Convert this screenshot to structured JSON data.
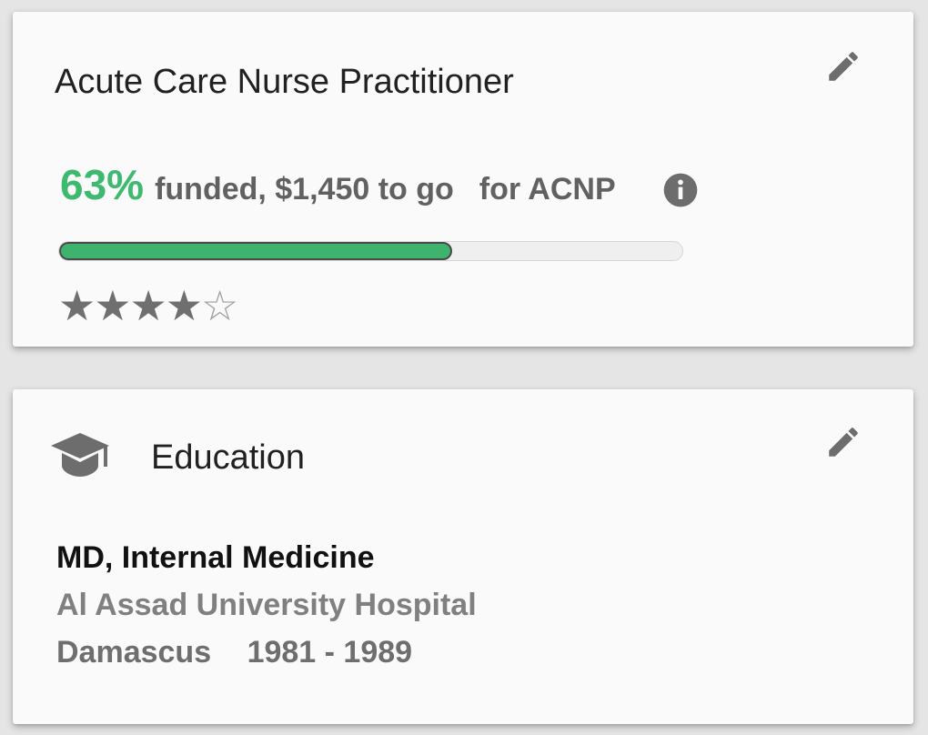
{
  "goal_card": {
    "title": "Acute Care Nurse Practitioner",
    "funded_percent": "63%",
    "funded_text": "funded, $1,450 to go",
    "for_text": "for ACNP",
    "progress_fraction": 0.63,
    "rating": {
      "filled": 4,
      "total": 5,
      "filled_glyph": "★",
      "empty_glyph": "☆"
    },
    "icons": {
      "edit": "pencil-icon",
      "info": "info-icon"
    },
    "colors": {
      "accent": "#3dba6f",
      "progress_fill": "#3db36e",
      "text_secondary": "#616161"
    }
  },
  "education_card": {
    "title": "Education",
    "degree": "MD, Internal Medicine",
    "school": "Al Assad University Hospital",
    "location": "Damascus",
    "years": "1981 - 1989",
    "icons": {
      "section": "graduation-cap-icon",
      "edit": "pencil-icon"
    }
  }
}
